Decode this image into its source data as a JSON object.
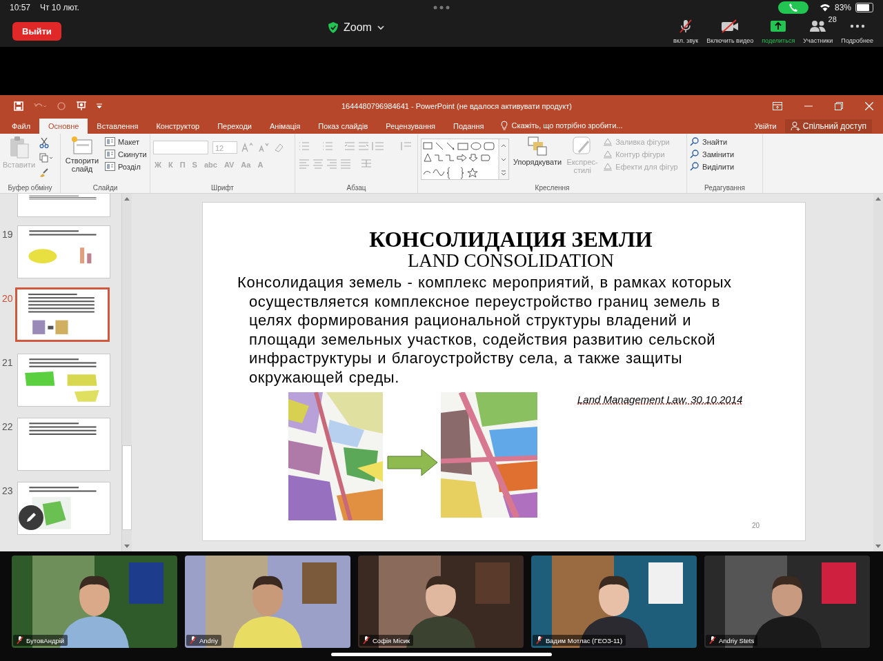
{
  "status_bar": {
    "time": "10:57",
    "date": "Чт 10 лют.",
    "battery": "83%"
  },
  "zoom_toolbar": {
    "leave_button": "Выйти",
    "meeting_title": "Zoom",
    "controls": [
      {
        "label": "вкл. звук",
        "kind": "mic"
      },
      {
        "label": "Включить видео",
        "kind": "video"
      },
      {
        "label": "поделиться",
        "kind": "share"
      },
      {
        "label": "Участники",
        "kind": "participants",
        "count": "28"
      },
      {
        "label": "Подробнее",
        "kind": "more"
      }
    ]
  },
  "powerpoint": {
    "title": "1644480796984641 - PowerPoint (не вдалося активувати продукт)",
    "tabs": [
      {
        "label": "Файл",
        "selected": false
      },
      {
        "label": "Основне",
        "selected": true
      },
      {
        "label": "Вставлення",
        "selected": false
      },
      {
        "label": "Конструктор",
        "selected": false
      },
      {
        "label": "Переходи",
        "selected": false
      },
      {
        "label": "Анімація",
        "selected": false
      },
      {
        "label": "Показ слайдів",
        "selected": false
      },
      {
        "label": "Рецензування",
        "selected": false
      },
      {
        "label": "Подання",
        "selected": false
      }
    ],
    "tell_me": "Скажіть, що потрібно зробити...",
    "sign_in": "Увійти",
    "share": "Спільний доступ",
    "ribbon": {
      "clipboard": {
        "label": "Буфер обміну",
        "paste": {
          "label": "Вставити",
          "disabled": true
        }
      },
      "slides": {
        "label": "Слайди",
        "new_slide": "Створити слайд",
        "items": [
          {
            "label": "Макет"
          },
          {
            "label": "Скинути"
          },
          {
            "label": "Розділ"
          }
        ]
      },
      "font": {
        "label": "Шрифт",
        "size": "12",
        "disabled": true,
        "format_buttons": [
          "Ж",
          "К",
          "П",
          "S",
          "abc",
          "AV",
          "Aa",
          "A"
        ]
      },
      "paragraph": {
        "label": "Абзац"
      },
      "drawing": {
        "label": "Креслення",
        "arrange": "Упорядкувати",
        "quick_styles": {
          "label": "Експрес-стилі",
          "disabled": true
        },
        "items": [
          {
            "label": "Заливка фігури",
            "disabled": true
          },
          {
            "label": "Контур фігури",
            "disabled": true
          },
          {
            "label": "Ефекти для фігур",
            "disabled": true
          }
        ]
      },
      "editing": {
        "label": "Редагування",
        "items": [
          {
            "label": "Знайти",
            "disabled": false
          },
          {
            "label": "Замінити",
            "disabled": false
          },
          {
            "label": "Виділити",
            "disabled": false
          }
        ]
      }
    },
    "thumbnails": [
      {
        "selected": false
      },
      {
        "number": "19",
        "selected": false
      },
      {
        "number": "20",
        "selected": true
      },
      {
        "number": "21",
        "selected": false
      },
      {
        "number": "22",
        "selected": false
      },
      {
        "number": "23",
        "selected": false
      }
    ],
    "slide": {
      "title": "КОНСОЛИДАЦИЯ ЗЕМЛИ",
      "subtitle": "LAND CONSOLIDATION",
      "body": "Консолидация земель - комплекс мероприятий, в рамках которых осуществляется комплексное переустройство границ земель в целях формирования рациональной структуры владений и площади земельных участков, содействия развитию сельской инфраструктуры и благоустройству села, а также защиты окружающей среды.",
      "citation": "Land Management Law, 30.10.2014",
      "number": "20"
    }
  },
  "participants": [
    {
      "name": "БутовАндрій",
      "muted": true
    },
    {
      "name": "Andriy",
      "muted": true
    },
    {
      "name": "Софія Місик",
      "muted": true
    },
    {
      "name": "Вадим Мотлас (ГЕОЗ-11)",
      "muted": true
    },
    {
      "name": "Andriy Stets",
      "muted": true
    }
  ]
}
